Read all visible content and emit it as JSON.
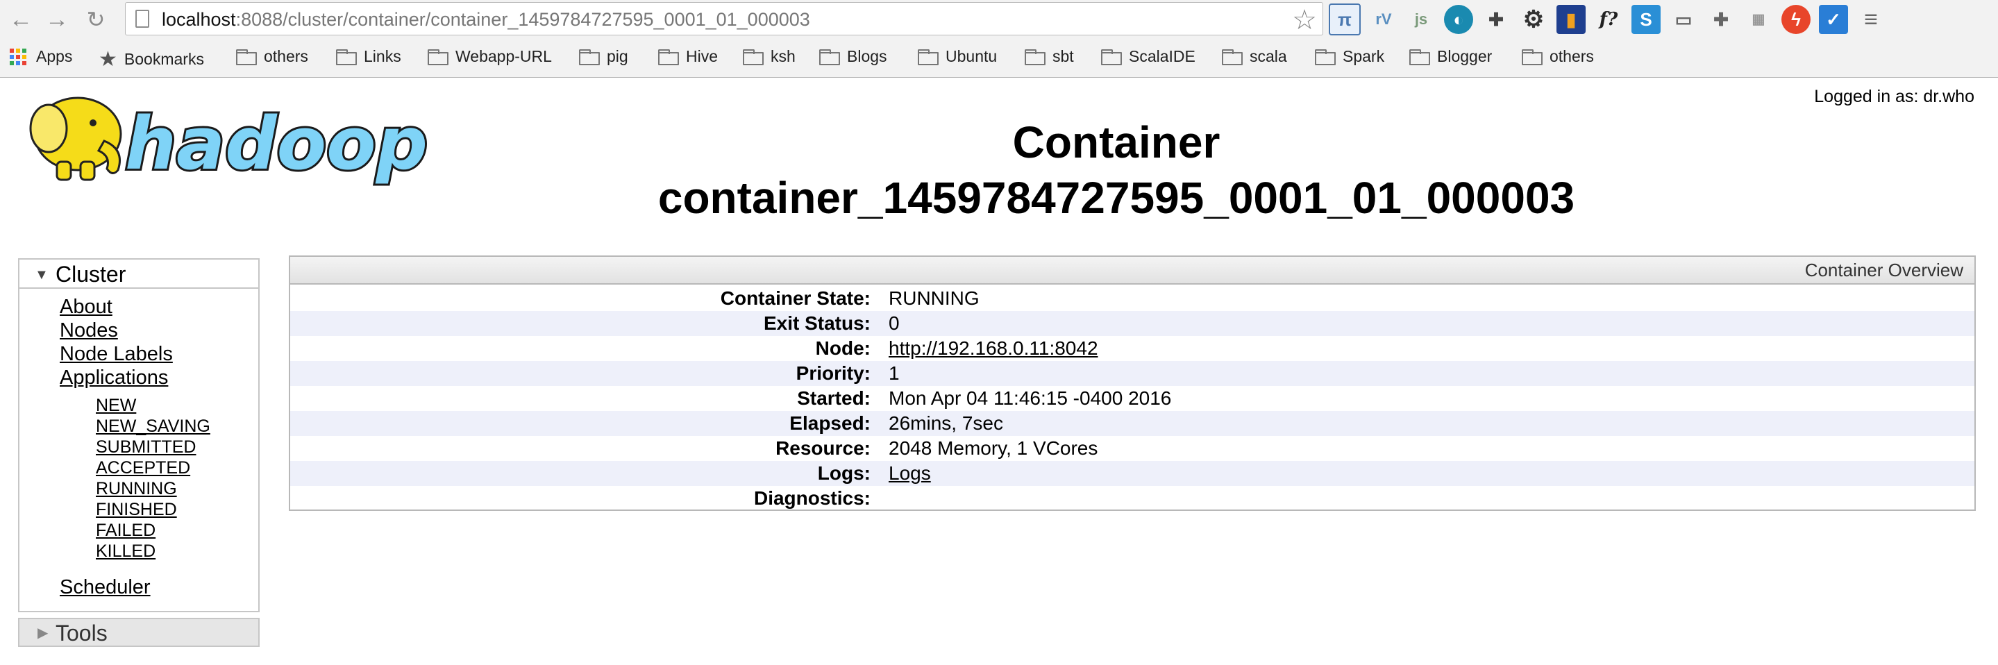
{
  "browser": {
    "url_host": "localhost",
    "url_path": ":8088/cluster/container/container_1459784727595_0001_01_000003",
    "bookmarks": [
      "Apps",
      "Bookmarks",
      "others",
      "Links",
      "Webapp-URL",
      "pig",
      "Hive",
      "ksh",
      "Blogs",
      "Ubuntu",
      "sbt",
      "ScalaIDE",
      "scala",
      "Spark",
      "Blogger",
      "others"
    ]
  },
  "header": {
    "logged_in": "Logged in as: dr.who",
    "title_line1": "Container",
    "title_line2": "container_1459784727595_0001_01_000003"
  },
  "nav": {
    "cluster_label": "Cluster",
    "items": [
      "About",
      "Nodes",
      "Node Labels",
      "Applications"
    ],
    "app_states": [
      "NEW",
      "NEW_SAVING",
      "SUBMITTED",
      "ACCEPTED",
      "RUNNING",
      "FINISHED",
      "FAILED",
      "KILLED"
    ],
    "scheduler": "Scheduler",
    "tools_label": "Tools"
  },
  "overview": {
    "title": "Container Overview",
    "rows": [
      {
        "key": "Container State:",
        "value": "RUNNING"
      },
      {
        "key": "Exit Status:",
        "value": "0"
      },
      {
        "key": "Node:",
        "value": "http://192.168.0.11:8042",
        "link": true
      },
      {
        "key": "Priority:",
        "value": "1"
      },
      {
        "key": "Started:",
        "value": "Mon Apr 04 11:46:15 -0400 2016"
      },
      {
        "key": "Elapsed:",
        "value": "26mins, 7sec"
      },
      {
        "key": "Resource:",
        "value": "2048 Memory, 1 VCores"
      },
      {
        "key": "Logs:",
        "value": "Logs",
        "link": true
      },
      {
        "key": "Diagnostics:",
        "value": ""
      }
    ]
  },
  "logo_text": "hadoop",
  "colors": {
    "logo_yellow": "#f5dc19",
    "logo_blue": "#7fd3f7",
    "row_alt": "#eef0fa"
  }
}
